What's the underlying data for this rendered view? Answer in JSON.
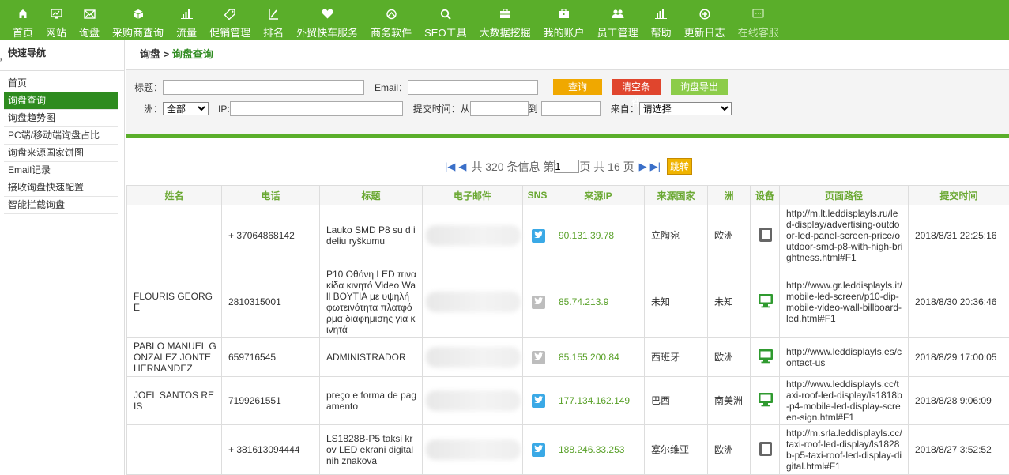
{
  "nav": [
    {
      "label": "首页",
      "icon": "home-icon"
    },
    {
      "label": "网站",
      "icon": "monitor-icon"
    },
    {
      "label": "询盘",
      "icon": "mail-icon"
    },
    {
      "label": "采购商查询",
      "icon": "cube-icon"
    },
    {
      "label": "流量",
      "icon": "bar-chart-icon"
    },
    {
      "label": "促销管理",
      "icon": "tag-icon"
    },
    {
      "label": "排名",
      "icon": "ranking-icon"
    },
    {
      "label": "外贸快车服务",
      "icon": "heart-icon"
    },
    {
      "label": "商务软件",
      "icon": "software-icon"
    },
    {
      "label": "SEO工具",
      "icon": "search-icon"
    },
    {
      "label": "大数据挖掘",
      "icon": "briefcase-icon"
    },
    {
      "label": "我的账户",
      "icon": "account-icon"
    },
    {
      "label": "员工管理",
      "icon": "users-icon"
    },
    {
      "label": "帮助",
      "icon": "help-chart-icon"
    },
    {
      "label": "更新日志",
      "icon": "plus-circle-icon"
    },
    {
      "label": "在线客服",
      "icon": "chat-icon"
    }
  ],
  "sidebar": {
    "title": "快速导航",
    "items": [
      {
        "label": "首页",
        "active": false
      },
      {
        "label": "询盘查询",
        "active": true
      },
      {
        "label": "询盘趋势图",
        "active": false
      },
      {
        "label": "PC端/移动端询盘占比",
        "active": false
      },
      {
        "label": "询盘来源国家饼图",
        "active": false
      },
      {
        "label": "Email记录",
        "active": false
      },
      {
        "label": "接收询盘快速配置",
        "active": false
      },
      {
        "label": "智能拦截询盘",
        "active": false
      }
    ]
  },
  "breadcrumb": {
    "parent": "询盘",
    "sep": " > ",
    "current": "询盘查询"
  },
  "filters": {
    "title_label": "标题：",
    "email_label": "Email：",
    "query_btn": "查询",
    "clear_btn": "清空条件",
    "export_btn": "询盘导出",
    "continent_label": "洲：",
    "continent_value": "全部",
    "ip_label": "IP:",
    "time_label": "提交时间：从",
    "to_label": "到",
    "source_label": "来自：",
    "source_value": "请选择"
  },
  "pager": {
    "total_text": "共 320 条信息 第",
    "page": "1",
    "pages_text": "页 共 16 页",
    "go": "跳转"
  },
  "table": {
    "headers": [
      "姓名",
      "电话",
      "标题",
      "电子邮件",
      "SNS",
      "来源IP",
      "来源国家",
      "洲",
      "设备",
      "页面路径",
      "提交时间"
    ],
    "rows": [
      {
        "name": "",
        "phone": "+ 37064868142",
        "title": "Lauko SMD P8 su d ideliu ryškumu",
        "sns": "twitter-on",
        "ip": "90.131.39.78",
        "country": "立陶宛",
        "continent": "欧洲",
        "device": "tablet-icon",
        "path": "http://m.lt.leddisplayls.ru/led-display/advertising-outdoor-led-panel-screen-price/outdoor-smd-p8-with-high-brightness.html#F1",
        "time": "2018/8/31 22:25:16"
      },
      {
        "name": "FLOURIS GEORGE",
        "phone": "2810315001",
        "title": "P10 Οθόνη LED πινακίδα κινητό Video Wall ΒΟΥΤΙΑ με υψηλή φωτεινότητα πλατφόρμα διαφήμισης για κινητά",
        "sns": "twitter-off",
        "ip": "85.74.213.9",
        "country": "未知",
        "continent": "未知",
        "device": "desktop-icon",
        "path": "http://www.gr.leddisplayls.it/mobile-led-screen/p10-dip-mobile-video-wall-billboard-led.html#F1",
        "time": "2018/8/30 20:36:46"
      },
      {
        "name": "PABLO MANUEL GONZALEZ JONTE HERNANDEZ",
        "phone": "659716545",
        "title": "ADMINISTRADOR",
        "sns": "twitter-off",
        "ip": "85.155.200.84",
        "country": "西班牙",
        "continent": "欧洲",
        "device": "desktop-icon",
        "path": "http://www.leddisplayls.es/contact-us",
        "time": "2018/8/29 17:00:05"
      },
      {
        "name": "JOEL SANTOS REIS",
        "phone": "7199261551",
        "title": "preço e forma de pagamento",
        "sns": "twitter-on",
        "ip": "177.134.162.149",
        "country": "巴西",
        "continent": "南美洲",
        "device": "desktop-icon",
        "path": "http://www.leddisplayls.cc/taxi-roof-led-display/ls1818b-p4-mobile-led-display-screen-sign.html#F1",
        "time": "2018/8/28 9:06:09"
      },
      {
        "name": "",
        "phone": "+ 381613094444",
        "title": "LS1828B-P5 taksi krov LED ekrani digitalnih znakova",
        "sns": "twitter-on",
        "ip": "188.246.33.253",
        "country": "塞尔维亚",
        "continent": "欧洲",
        "device": "tablet-icon",
        "path": "http://m.srla.leddisplayls.cc/taxi-roof-led-display/ls1828b-p5-taxi-roof-led-display-digital.html#F1",
        "time": "2018/8/27 3:52:52"
      }
    ]
  },
  "colors": {
    "nav_bg": "#5aae2a",
    "accent": "#2e8b1f",
    "ip_green": "#5aa12a",
    "twitter": "#3aa9e6"
  }
}
